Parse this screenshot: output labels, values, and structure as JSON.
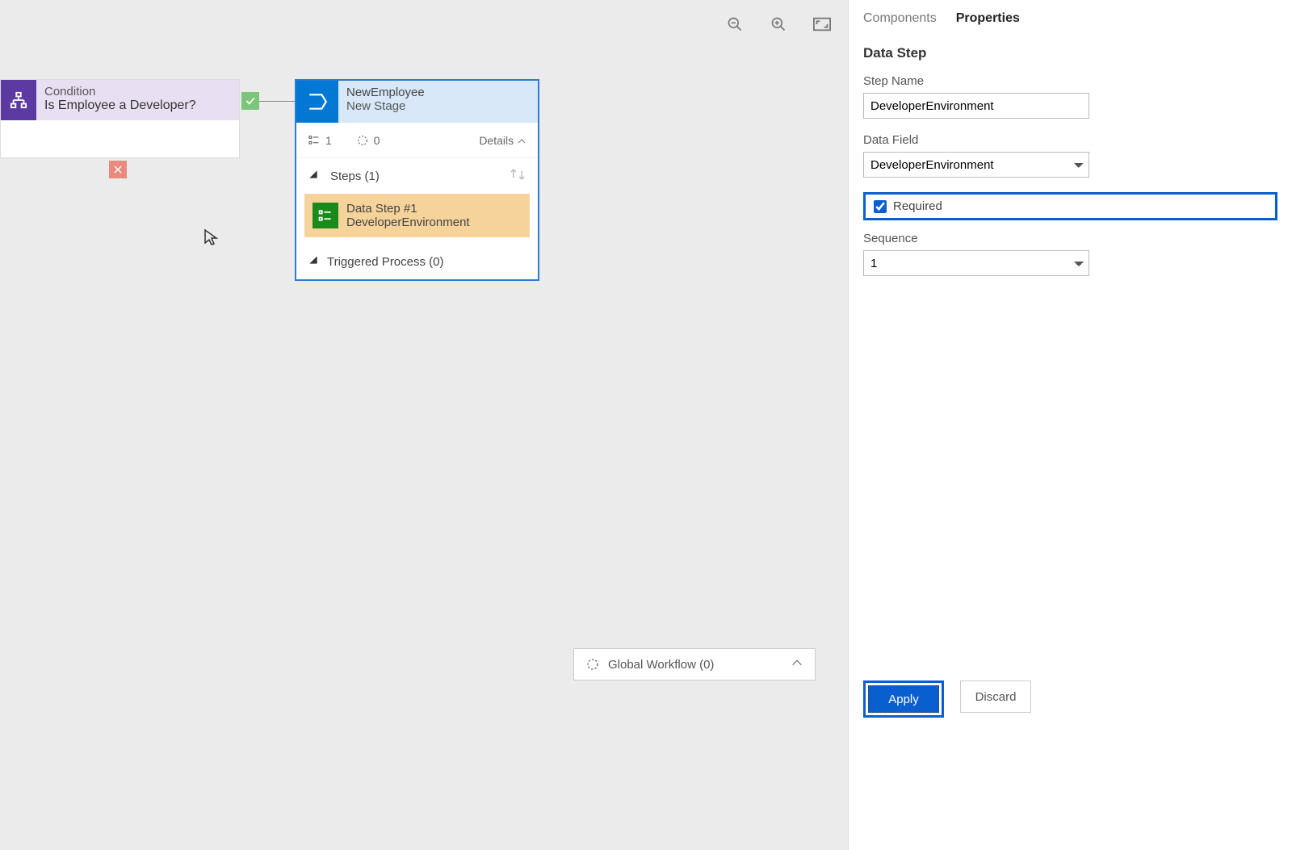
{
  "canvas": {
    "condition": {
      "label": "Condition",
      "question": "Is Employee a Developer?"
    },
    "stage": {
      "title": "NewEmployee",
      "subtitle": "New Stage",
      "meta_count1": "1",
      "meta_count2": "0",
      "details_label": "Details",
      "steps_label": "Steps (1)",
      "datastep_line1": "Data Step #1",
      "datastep_line2": "DeveloperEnvironment",
      "triggered_label": "Triggered Process (0)"
    },
    "global_workflow_label": "Global Workflow (0)"
  },
  "panel": {
    "tabs": {
      "components": "Components",
      "properties": "Properties"
    },
    "heading": "Data Step",
    "step_name_label": "Step Name",
    "step_name_value": "DeveloperEnvironment",
    "data_field_label": "Data Field",
    "data_field_value": "DeveloperEnvironment",
    "required_label": "Required",
    "sequence_label": "Sequence",
    "sequence_value": "1",
    "apply_label": "Apply",
    "discard_label": "Discard"
  }
}
